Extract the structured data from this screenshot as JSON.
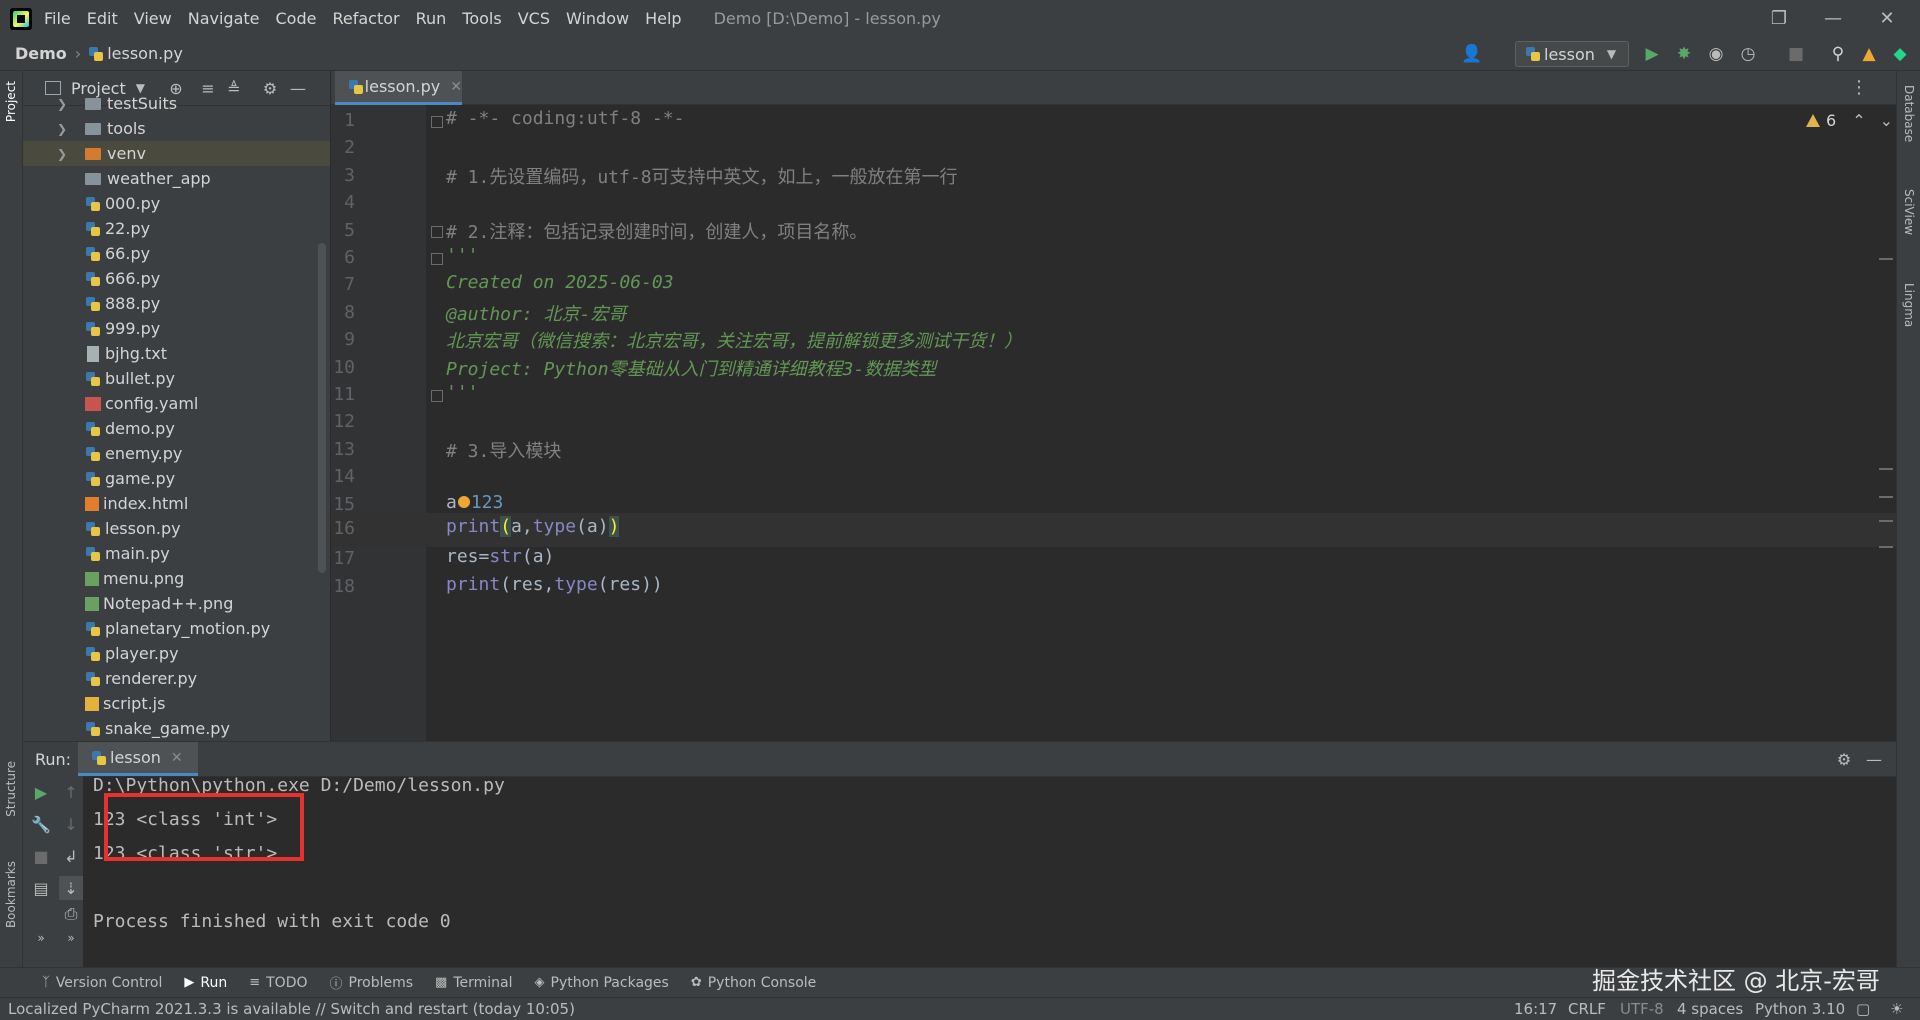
{
  "menubar": {
    "items": [
      "File",
      "Edit",
      "View",
      "Navigate",
      "Code",
      "Refactor",
      "Run",
      "Tools",
      "VCS",
      "Window",
      "Help"
    ],
    "title": "Demo [D:\\Demo] - lesson.py"
  },
  "navbar": {
    "project": "Demo",
    "file": "lesson.py",
    "run_config": "lesson"
  },
  "left_strip": {
    "project": "Project",
    "structure": "Structure",
    "bookmarks": "Bookmarks"
  },
  "right_strip": {
    "database": "Database",
    "sciview": "SciView",
    "lingma": "Lingma"
  },
  "project_panel": {
    "title": "Project",
    "tree": [
      {
        "name": "testSuits",
        "type": "folder",
        "arrow": true
      },
      {
        "name": "tools",
        "type": "folder",
        "arrow": true
      },
      {
        "name": "venv",
        "type": "folder-orange",
        "arrow": true,
        "highlight": true
      },
      {
        "name": "weather_app",
        "type": "folder",
        "arrow": false
      },
      {
        "name": "000.py",
        "type": "py"
      },
      {
        "name": "22.py",
        "type": "py"
      },
      {
        "name": "66.py",
        "type": "py"
      },
      {
        "name": "666.py",
        "type": "py"
      },
      {
        "name": "888.py",
        "type": "py"
      },
      {
        "name": "999.py",
        "type": "py"
      },
      {
        "name": "bjhg.txt",
        "type": "txt"
      },
      {
        "name": "bullet.py",
        "type": "py"
      },
      {
        "name": "config.yaml",
        "type": "yml"
      },
      {
        "name": "demo.py",
        "type": "py"
      },
      {
        "name": "enemy.py",
        "type": "py"
      },
      {
        "name": "game.py",
        "type": "py"
      },
      {
        "name": "index.html",
        "type": "html"
      },
      {
        "name": "lesson.py",
        "type": "py"
      },
      {
        "name": "main.py",
        "type": "py"
      },
      {
        "name": "menu.png",
        "type": "png"
      },
      {
        "name": "Notepad++.png",
        "type": "png"
      },
      {
        "name": "planetary_motion.py",
        "type": "py"
      },
      {
        "name": "player.py",
        "type": "py"
      },
      {
        "name": "renderer.py",
        "type": "py"
      },
      {
        "name": "script.js",
        "type": "js"
      },
      {
        "name": "snake_game.py",
        "type": "py"
      }
    ]
  },
  "editor": {
    "tab": "lesson.py",
    "warnings": "6",
    "lines": [
      {
        "n": "1",
        "text": "# -*- coding:utf-8 -*-",
        "cls": "c-com"
      },
      {
        "n": "2",
        "text": "",
        "cls": ""
      },
      {
        "n": "3",
        "text": "# 1.先设置编码，utf-8可支持中英文，如上，一般放在第一行",
        "cls": "c-com"
      },
      {
        "n": "4",
        "text": "",
        "cls": ""
      },
      {
        "n": "5",
        "text": "# 2.注释：包括记录创建时间，创建人，项目名称。",
        "cls": "c-com"
      },
      {
        "n": "6",
        "text": "'''",
        "cls": "c-doc"
      },
      {
        "n": "7",
        "text": "Created on 2025-06-03",
        "cls": "c-doc"
      },
      {
        "n": "8",
        "text": "@author: 北京-宏哥",
        "cls": "c-doc"
      },
      {
        "n": "9",
        "text": "北京宏哥（微信搜索：北京宏哥，关注宏哥，提前解锁更多测试干货！）",
        "cls": "c-doc"
      },
      {
        "n": "10",
        "text": "Project: Python零基础从入门到精通详细教程3-数据类型",
        "cls": "c-doc"
      },
      {
        "n": "11",
        "text": "'''",
        "cls": "c-doc"
      },
      {
        "n": "12",
        "text": "",
        "cls": ""
      },
      {
        "n": "13",
        "text": "# 3.导入模块",
        "cls": "c-com"
      },
      {
        "n": "14",
        "text": "",
        "cls": ""
      },
      {
        "n": "15",
        "text": "a=123",
        "cls": "assign"
      },
      {
        "n": "16",
        "text": "print(a,type(a))",
        "cls": "print1"
      },
      {
        "n": "17",
        "text": "res=str(a)",
        "cls": "assign2"
      },
      {
        "n": "18",
        "text": "print(res,type(res))",
        "cls": "print2"
      }
    ]
  },
  "run_panel": {
    "label": "Run:",
    "tab": "lesson",
    "console": [
      "D:\\Python\\python.exe D:/Demo/lesson.py",
      "123 <class 'int'>",
      "123 <class 'str'>",
      "",
      "Process finished with exit code 0"
    ]
  },
  "tool_tabs": [
    "Version Control",
    "Run",
    "TODO",
    "Problems",
    "Terminal",
    "Python Packages",
    "Python Console"
  ],
  "statusbar": {
    "message": "Localized PyCharm 2021.3.3 is available // Switch and restart (today 10:05)",
    "position": "16:17",
    "line_sep": "CRLF",
    "encoding": "UTF-8",
    "indent": "4 spaces",
    "interpreter": "Python 3.10"
  },
  "watermark": "掘金技术社区 @ 北京-宏哥",
  "colors": {
    "accent": "#4a88c7",
    "highlight_box": "#e8302e",
    "docstring": "#629755",
    "comment": "#808080"
  }
}
